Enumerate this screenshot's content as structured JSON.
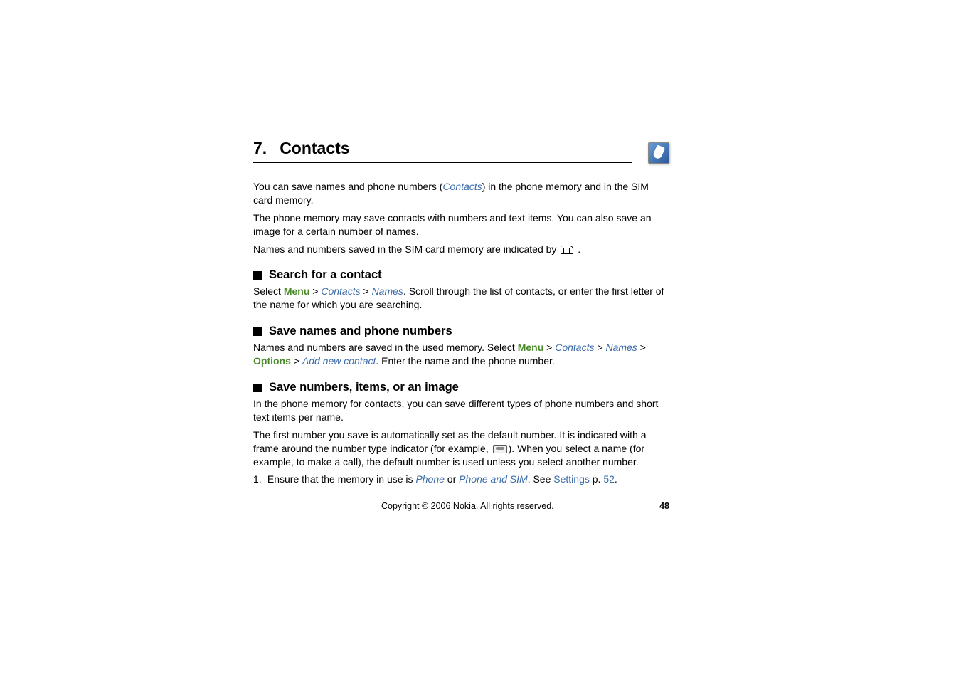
{
  "chapter": {
    "number": "7.",
    "title": "Contacts"
  },
  "intro": {
    "p1_pre": "You can save names and phone numbers (",
    "p1_contacts": "Contacts",
    "p1_post": ") in the phone memory and in the SIM card memory.",
    "p2": "The phone memory may save contacts with numbers and text items. You can also save an image for a certain number of names.",
    "p3": "Names and numbers saved in the SIM card memory are indicated by "
  },
  "section1": {
    "title": "Search for a contact",
    "text_pre": "Select ",
    "menu": "Menu",
    "gt1": " > ",
    "contacts": "Contacts",
    "gt2": " > ",
    "names": "Names",
    "text_post": ". Scroll through the list of contacts, or enter the first letter of the name for which you are searching."
  },
  "section2": {
    "title": "Save names and phone numbers",
    "text_pre": "Names and numbers are saved in the used memory. Select ",
    "menu": "Menu",
    "gt1": " > ",
    "contacts": "Contacts",
    "gt2": " > ",
    "names": "Names",
    "gt3": " > ",
    "options": "Options",
    "gt4": " > ",
    "addnew": "Add new contact",
    "text_post": ". Enter the name and the phone number."
  },
  "section3": {
    "title": "Save numbers, items, or an image",
    "p1": "In the phone memory for contacts, you can save different types of phone numbers and short text items per name.",
    "p2_pre": "The first number you save is automatically set as the default number. It is indicated with a frame around the number type indicator (for example, ",
    "p2_post": "). When you select a name (for example, to make a call), the default number is used unless you select another number.",
    "item1_num": "1.",
    "item1_pre": "Ensure that the memory in use is ",
    "phone": "Phone",
    "item1_or": " or ",
    "phone_sim": "Phone and SIM",
    "item1_see": ". See ",
    "settings": "Settings",
    "item1_p": " p. ",
    "page52": "52",
    "item1_end": "."
  },
  "footer": {
    "copyright": "Copyright © 2006 Nokia. All rights reserved.",
    "page": "48"
  }
}
